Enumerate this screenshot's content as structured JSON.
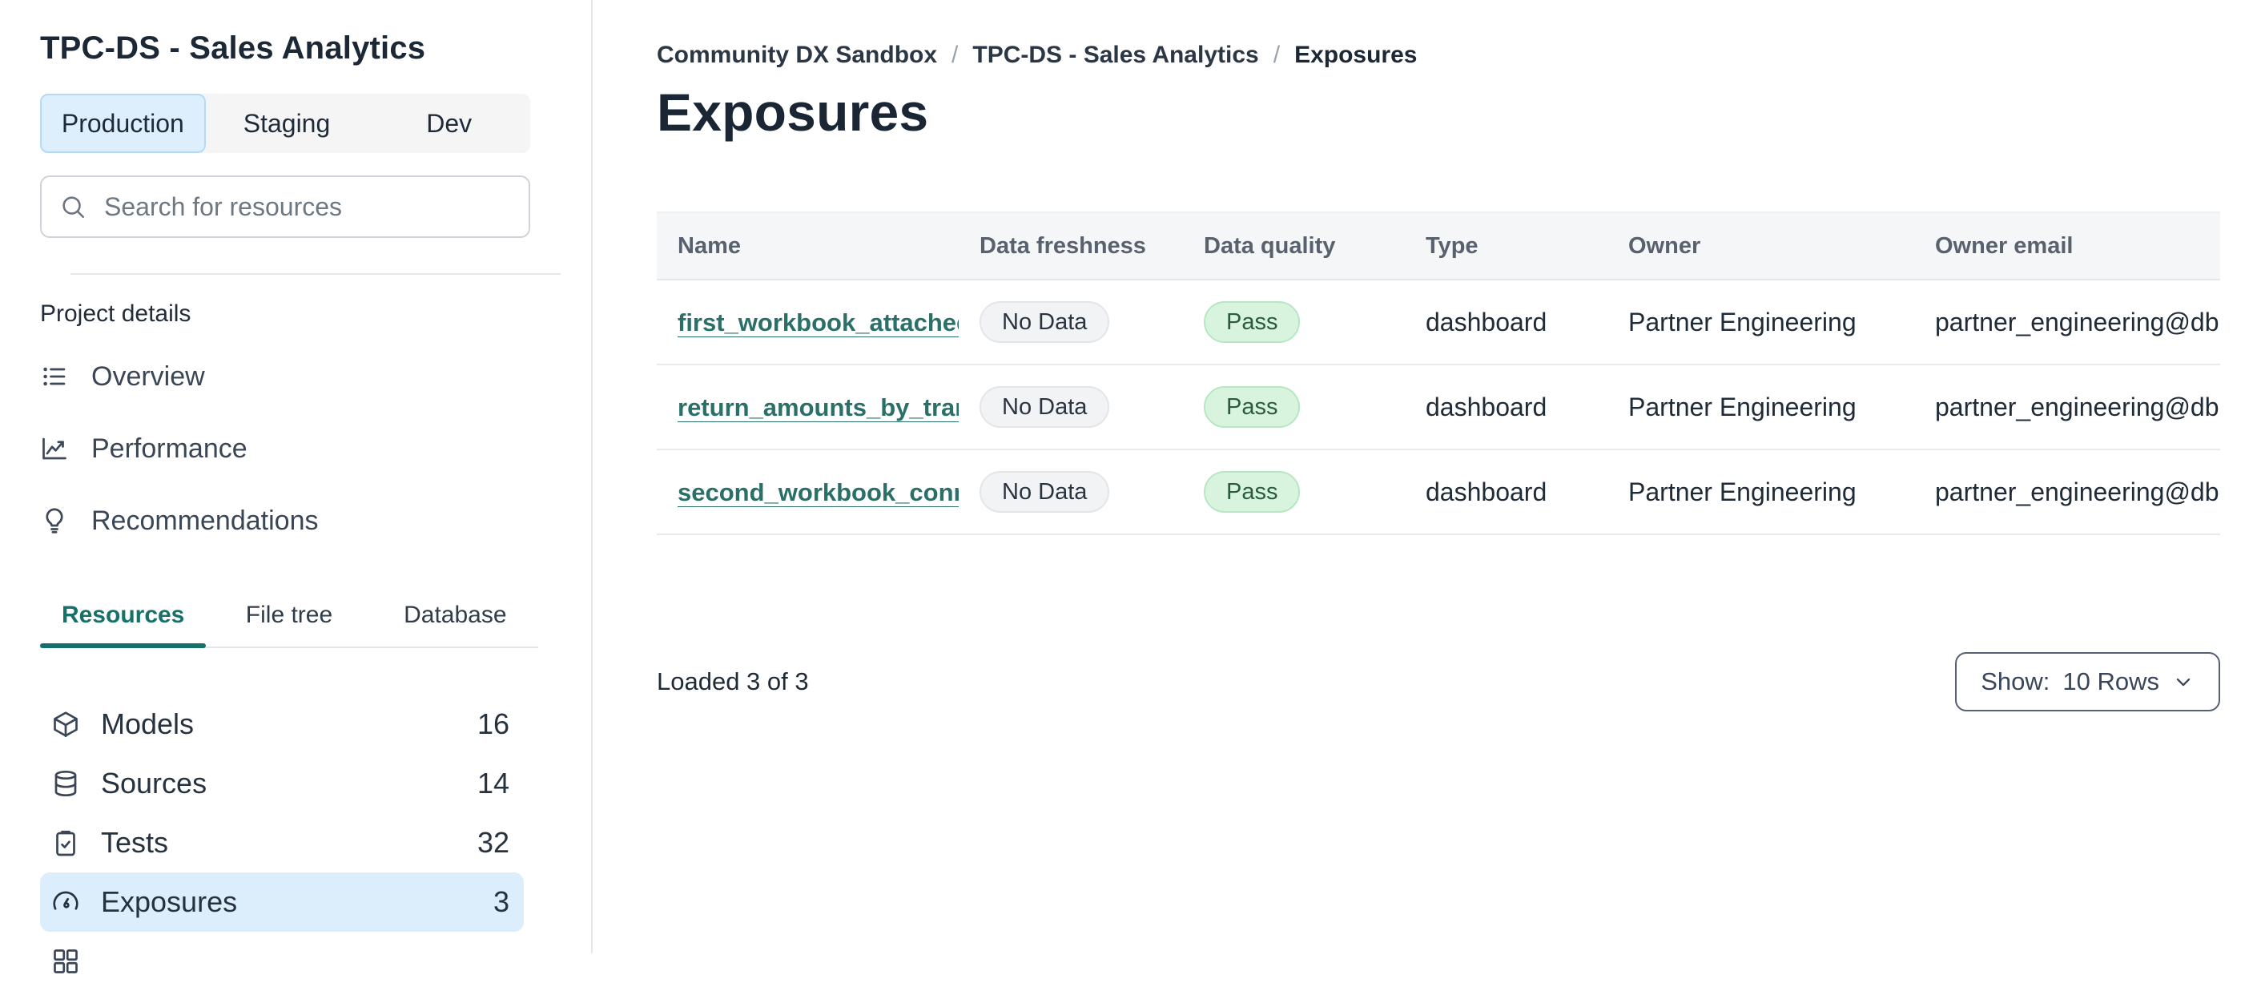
{
  "colors": {
    "border": "#e5e7ea",
    "text_dark": "#1d2836",
    "text_muted": "#58616d",
    "accent_blue_bg": "#ddeffd",
    "accent_blue_border": "#b5daf6",
    "row_highlight": "#dcedfc",
    "teal": "#15716a",
    "link_teal": "#2a6f68",
    "header_bg": "#f5f6f8",
    "pill_gray_bg": "#f2f3f5",
    "pill_gray_border": "#e3e5e9",
    "pill_green_bg": "#d9f4de",
    "pill_green_border": "#b6e7c2",
    "pill_green_text": "#2b5c40"
  },
  "sidebar": {
    "project_title": "TPC-DS - Sales Analytics",
    "env_tabs": [
      {
        "label": "Production",
        "active": true
      },
      {
        "label": "Staging",
        "active": false
      },
      {
        "label": "Dev",
        "active": false
      }
    ],
    "search": {
      "placeholder": "Search for resources"
    },
    "section_label": "Project details",
    "nav": [
      {
        "icon": "overview-icon",
        "label": "Overview"
      },
      {
        "icon": "performance-icon",
        "label": "Performance"
      },
      {
        "icon": "recommendations-icon",
        "label": "Recommendations"
      }
    ],
    "view_tabs": [
      {
        "label": "Resources",
        "active": true
      },
      {
        "label": "File tree",
        "active": false
      },
      {
        "label": "Database",
        "active": false
      }
    ],
    "resources": [
      {
        "icon": "models-icon",
        "label": "Models",
        "count": "16",
        "active": false
      },
      {
        "icon": "sources-icon",
        "label": "Sources",
        "count": "14",
        "active": false
      },
      {
        "icon": "tests-icon",
        "label": "Tests",
        "count": "32",
        "active": false
      },
      {
        "icon": "exposures-icon",
        "label": "Exposures",
        "count": "3",
        "active": true
      }
    ]
  },
  "main": {
    "breadcrumb": [
      {
        "label": "Community DX Sandbox"
      },
      {
        "label": "TPC-DS - Sales Analytics"
      },
      {
        "label": "Exposures",
        "current": true
      }
    ],
    "breadcrumb_separator": "/",
    "title": "Exposures",
    "table": {
      "columns": [
        "Name",
        "Data freshness",
        "Data quality",
        "Type",
        "Owner",
        "Owner email"
      ],
      "ellipsis": "...",
      "rows": [
        {
          "name": "first_workbook_attached",
          "freshness": "No Data",
          "quality": "Pass",
          "type": "dashboard",
          "owner": "Partner Engineering",
          "owner_email": "partner_engineering@dbt..."
        },
        {
          "name": "return_amounts_by_tran",
          "freshness": "No Data",
          "quality": "Pass",
          "type": "dashboard",
          "owner": "Partner Engineering",
          "owner_email": "partner_engineering@dbt..."
        },
        {
          "name": "second_workbook_conn",
          "freshness": "No Data",
          "quality": "Pass",
          "type": "dashboard",
          "owner": "Partner Engineering",
          "owner_email": "partner_engineering@dbt..."
        }
      ]
    },
    "footer": {
      "loaded_text": "Loaded 3 of 3",
      "show_label": "Show:",
      "show_value": "10 Rows"
    }
  }
}
